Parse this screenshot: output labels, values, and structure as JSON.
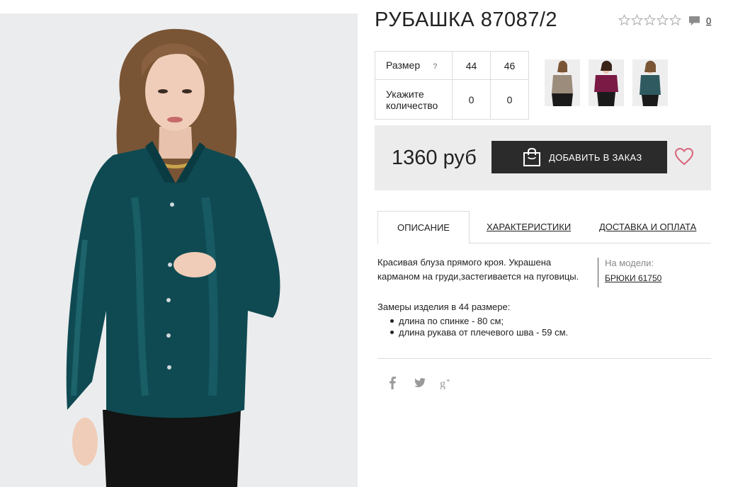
{
  "product": {
    "title": "РУБАШКА 87087/2",
    "rating_stars": 0,
    "rating_max": 5,
    "comment_count": "0"
  },
  "sizes": {
    "size_label": "Размер",
    "help": "?",
    "qty_label": "Укажите количество",
    "columns": [
      {
        "size": "44",
        "qty": "0"
      },
      {
        "size": "46",
        "qty": "0"
      }
    ]
  },
  "buy": {
    "price": "1360 руб",
    "add_label": "ДОБАВИТЬ В ЗАКАЗ"
  },
  "tabs": [
    {
      "label": "ОПИСАНИЕ",
      "active": true
    },
    {
      "label": "ХАРАКТЕРИСТИКИ",
      "active": false
    },
    {
      "label": "ДОСТАВКА И ОПЛАТА",
      "active": false
    }
  ],
  "description": {
    "text": "Красивая блуза прямого кроя. Украшена карманом на груди,застегивается на пуговицы.",
    "on_model_label": "На модели:",
    "on_model_link": "БРЮКИ 61750",
    "measures_title": "Замеры изделия в 44 размере:",
    "measures": [
      "длина по спинке - 80 см;",
      "длина рукава от плечевого шва - 59 см."
    ]
  },
  "colors": {
    "blouse": "#0f4a52",
    "accent_heart": "#d9637a",
    "button_dark": "#2b2b2b",
    "panel_bg": "#ececec"
  }
}
